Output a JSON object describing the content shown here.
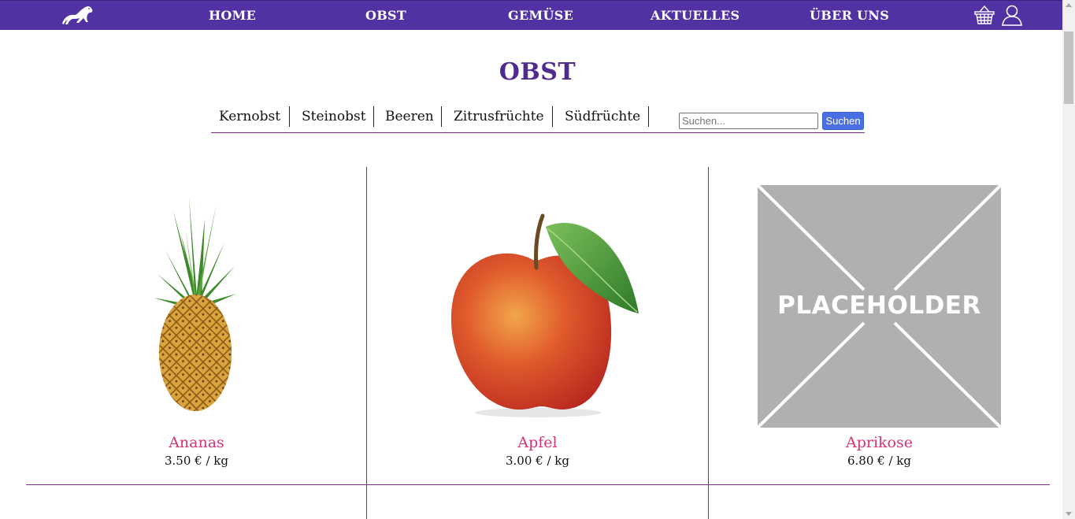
{
  "nav": {
    "logo": "ferret-logo-icon",
    "items": [
      {
        "label": "HOME"
      },
      {
        "label": "OBST"
      },
      {
        "label": "GEMÜSE"
      },
      {
        "label": "AKTUELLES"
      },
      {
        "label": "ÜBER UNS"
      }
    ],
    "cart_icon": "basket-icon",
    "user_icon": "user-icon",
    "bar_color": "#5231a3"
  },
  "page": {
    "title": "OBST",
    "title_color": "#4f2a8f"
  },
  "categories": [
    {
      "label": "Kernobst"
    },
    {
      "label": "Steinobst"
    },
    {
      "label": "Beeren"
    },
    {
      "label": "Zitrusfrüchte"
    },
    {
      "label": "Südfrüchte"
    }
  ],
  "search": {
    "placeholder": "Suchen...",
    "value": "",
    "button_label": "Suchen",
    "button_color": "#4a6fe3"
  },
  "products": [
    {
      "name": "Ananas",
      "price": "3.50 € / kg",
      "image": "pineapple-image"
    },
    {
      "name": "Apfel",
      "price": "3.00 € / kg",
      "image": "apple-image"
    },
    {
      "name": "Aprikose",
      "price": "6.80 € / kg",
      "image": "placeholder-image",
      "image_text": "PLACEHOLDER"
    }
  ],
  "colors": {
    "accent_line": "#7a2d86",
    "product_name": "#d6337a"
  }
}
